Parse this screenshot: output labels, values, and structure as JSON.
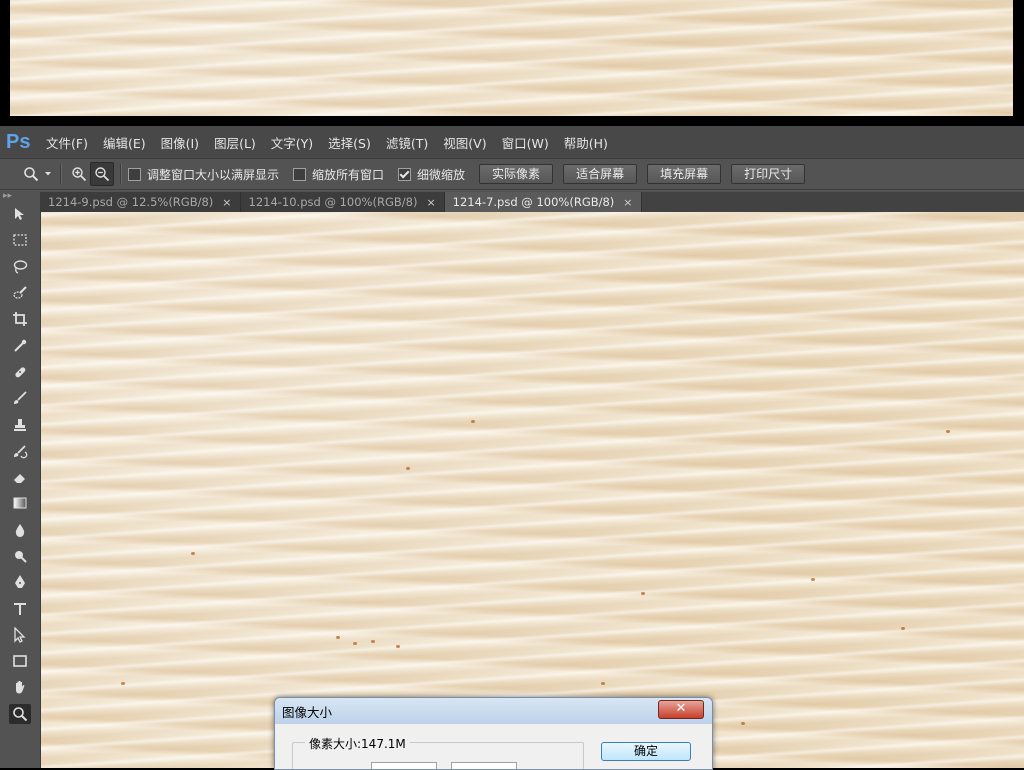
{
  "app": {
    "logo": "Ps"
  },
  "menubar": {
    "items": [
      "文件(F)",
      "编辑(E)",
      "图像(I)",
      "图层(L)",
      "文字(Y)",
      "选择(S)",
      "滤镜(T)",
      "视图(V)",
      "窗口(W)",
      "帮助(H)"
    ]
  },
  "options": {
    "tool_icon": "zoom-icon",
    "dropdown_icon": "chevron-down-icon",
    "zoom_in_icon": "zoom-in-icon",
    "zoom_out_icon": "zoom-out-icon",
    "checkboxes": [
      {
        "label": "调整窗口大小以满屏显示",
        "checked": false
      },
      {
        "label": "缩放所有窗口",
        "checked": false
      },
      {
        "label": "细微缩放",
        "checked": true
      }
    ],
    "buttons": [
      "实际像素",
      "适合屏幕",
      "填充屏幕",
      "打印尺寸"
    ]
  },
  "tabs": [
    {
      "label": "1214-9.psd @ 12.5%(RGB/8)",
      "active": false,
      "close": "×"
    },
    {
      "label": "1214-10.psd @ 100%(RGB/8)",
      "active": false,
      "close": "×"
    },
    {
      "label": "1214-7.psd @ 100%(RGB/8)",
      "active": true,
      "close": "×"
    }
  ],
  "toolbox": {
    "grip": "▸▸",
    "tools": [
      "move-icon",
      "marquee-icon",
      "lasso-icon",
      "quick-select-icon",
      "crop-icon",
      "eyedropper-icon",
      "healing-brush-icon",
      "brush-icon",
      "clone-stamp-icon",
      "history-brush-icon",
      "eraser-icon",
      "gradient-icon",
      "blur-icon",
      "dodge-icon",
      "pen-icon",
      "type-icon",
      "path-select-icon",
      "rectangle-icon",
      "hand-icon",
      "zoom-icon"
    ],
    "selected": "zoom-icon"
  },
  "dialog": {
    "title": "图像大小",
    "close_symbol": "✕",
    "pixel_size_label": "像素大小:147.1M",
    "ok_label": "确定"
  },
  "colors": {
    "accent_logo": "#5fa3e8",
    "ui_dark": "#535353",
    "marble": "#ecdcc0"
  }
}
